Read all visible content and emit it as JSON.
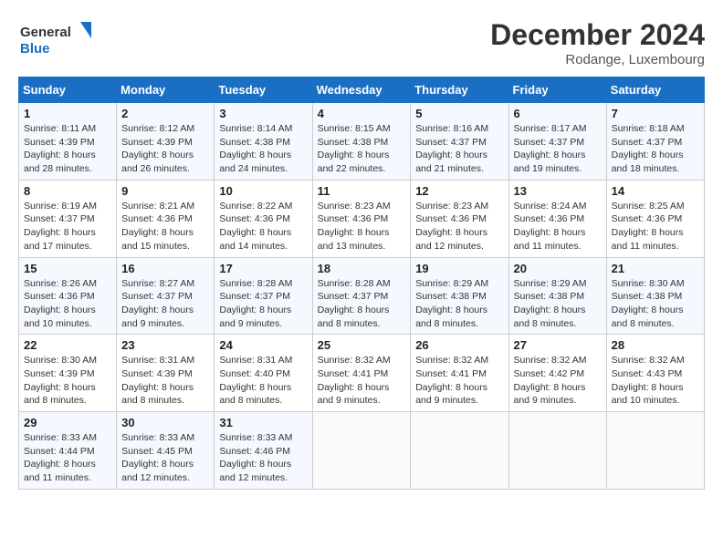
{
  "header": {
    "logo_line1": "General",
    "logo_line2": "Blue",
    "month_year": "December 2024",
    "location": "Rodange, Luxembourg"
  },
  "weekdays": [
    "Sunday",
    "Monday",
    "Tuesday",
    "Wednesday",
    "Thursday",
    "Friday",
    "Saturday"
  ],
  "weeks": [
    [
      {
        "day": "1",
        "sunrise": "8:11 AM",
        "sunset": "4:39 PM",
        "daylight": "8 hours and 28 minutes."
      },
      {
        "day": "2",
        "sunrise": "8:12 AM",
        "sunset": "4:39 PM",
        "daylight": "8 hours and 26 minutes."
      },
      {
        "day": "3",
        "sunrise": "8:14 AM",
        "sunset": "4:38 PM",
        "daylight": "8 hours and 24 minutes."
      },
      {
        "day": "4",
        "sunrise": "8:15 AM",
        "sunset": "4:38 PM",
        "daylight": "8 hours and 22 minutes."
      },
      {
        "day": "5",
        "sunrise": "8:16 AM",
        "sunset": "4:37 PM",
        "daylight": "8 hours and 21 minutes."
      },
      {
        "day": "6",
        "sunrise": "8:17 AM",
        "sunset": "4:37 PM",
        "daylight": "8 hours and 19 minutes."
      },
      {
        "day": "7",
        "sunrise": "8:18 AM",
        "sunset": "4:37 PM",
        "daylight": "8 hours and 18 minutes."
      }
    ],
    [
      {
        "day": "8",
        "sunrise": "8:19 AM",
        "sunset": "4:37 PM",
        "daylight": "8 hours and 17 minutes."
      },
      {
        "day": "9",
        "sunrise": "8:21 AM",
        "sunset": "4:36 PM",
        "daylight": "8 hours and 15 minutes."
      },
      {
        "day": "10",
        "sunrise": "8:22 AM",
        "sunset": "4:36 PM",
        "daylight": "8 hours and 14 minutes."
      },
      {
        "day": "11",
        "sunrise": "8:23 AM",
        "sunset": "4:36 PM",
        "daylight": "8 hours and 13 minutes."
      },
      {
        "day": "12",
        "sunrise": "8:23 AM",
        "sunset": "4:36 PM",
        "daylight": "8 hours and 12 minutes."
      },
      {
        "day": "13",
        "sunrise": "8:24 AM",
        "sunset": "4:36 PM",
        "daylight": "8 hours and 11 minutes."
      },
      {
        "day": "14",
        "sunrise": "8:25 AM",
        "sunset": "4:36 PM",
        "daylight": "8 hours and 11 minutes."
      }
    ],
    [
      {
        "day": "15",
        "sunrise": "8:26 AM",
        "sunset": "4:36 PM",
        "daylight": "8 hours and 10 minutes."
      },
      {
        "day": "16",
        "sunrise": "8:27 AM",
        "sunset": "4:37 PM",
        "daylight": "8 hours and 9 minutes."
      },
      {
        "day": "17",
        "sunrise": "8:28 AM",
        "sunset": "4:37 PM",
        "daylight": "8 hours and 9 minutes."
      },
      {
        "day": "18",
        "sunrise": "8:28 AM",
        "sunset": "4:37 PM",
        "daylight": "8 hours and 8 minutes."
      },
      {
        "day": "19",
        "sunrise": "8:29 AM",
        "sunset": "4:38 PM",
        "daylight": "8 hours and 8 minutes."
      },
      {
        "day": "20",
        "sunrise": "8:29 AM",
        "sunset": "4:38 PM",
        "daylight": "8 hours and 8 minutes."
      },
      {
        "day": "21",
        "sunrise": "8:30 AM",
        "sunset": "4:38 PM",
        "daylight": "8 hours and 8 minutes."
      }
    ],
    [
      {
        "day": "22",
        "sunrise": "8:30 AM",
        "sunset": "4:39 PM",
        "daylight": "8 hours and 8 minutes."
      },
      {
        "day": "23",
        "sunrise": "8:31 AM",
        "sunset": "4:39 PM",
        "daylight": "8 hours and 8 minutes."
      },
      {
        "day": "24",
        "sunrise": "8:31 AM",
        "sunset": "4:40 PM",
        "daylight": "8 hours and 8 minutes."
      },
      {
        "day": "25",
        "sunrise": "8:32 AM",
        "sunset": "4:41 PM",
        "daylight": "8 hours and 9 minutes."
      },
      {
        "day": "26",
        "sunrise": "8:32 AM",
        "sunset": "4:41 PM",
        "daylight": "8 hours and 9 minutes."
      },
      {
        "day": "27",
        "sunrise": "8:32 AM",
        "sunset": "4:42 PM",
        "daylight": "8 hours and 9 minutes."
      },
      {
        "day": "28",
        "sunrise": "8:32 AM",
        "sunset": "4:43 PM",
        "daylight": "8 hours and 10 minutes."
      }
    ],
    [
      {
        "day": "29",
        "sunrise": "8:33 AM",
        "sunset": "4:44 PM",
        "daylight": "8 hours and 11 minutes."
      },
      {
        "day": "30",
        "sunrise": "8:33 AM",
        "sunset": "4:45 PM",
        "daylight": "8 hours and 12 minutes."
      },
      {
        "day": "31",
        "sunrise": "8:33 AM",
        "sunset": "4:46 PM",
        "daylight": "8 hours and 12 minutes."
      },
      null,
      null,
      null,
      null
    ]
  ],
  "labels": {
    "sunrise": "Sunrise:",
    "sunset": "Sunset:",
    "daylight": "Daylight:"
  }
}
